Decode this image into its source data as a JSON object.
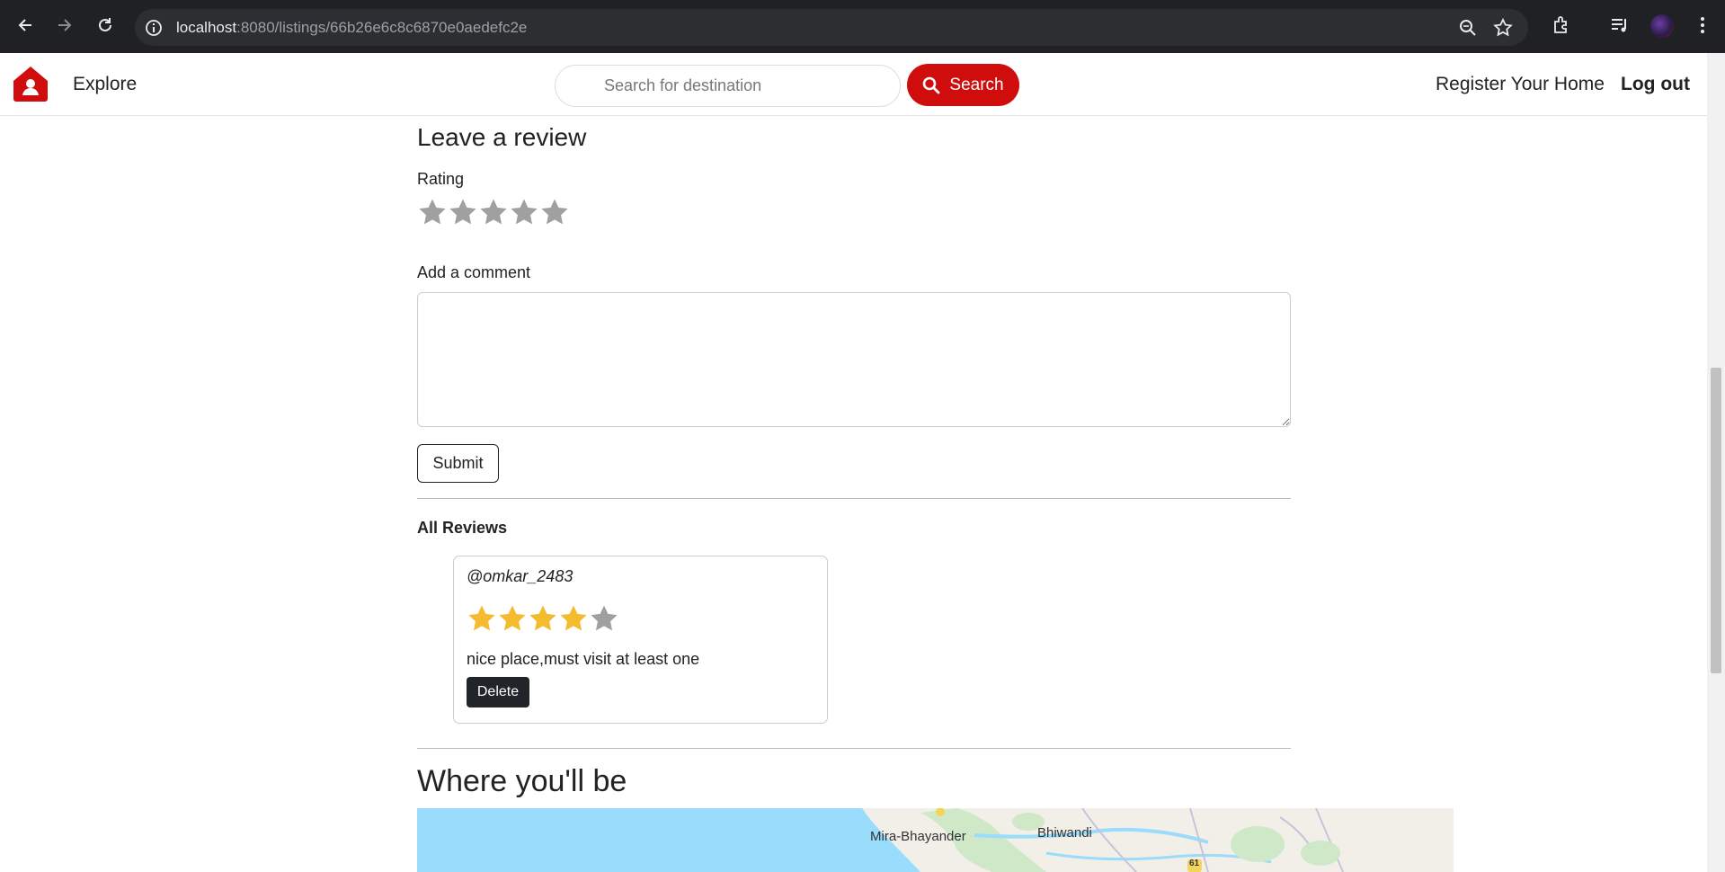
{
  "browser": {
    "url_host": "localhost",
    "url_path": ":8080/listings/66b26e6c8c6870e0aedefc2e"
  },
  "navbar": {
    "explore_label": "Explore",
    "search_placeholder": "Search for destination",
    "search_button_label": "Search",
    "register_label": "Register Your Home",
    "logout_label": "Log out",
    "brand_color": "#d00d0d"
  },
  "review_form": {
    "heading": "Leave a review",
    "rating_label": "Rating",
    "rating_value": 0,
    "rating_max": 5,
    "comment_label": "Add a comment",
    "comment_value": "",
    "submit_label": "Submit"
  },
  "reviews": {
    "heading": "All Reviews",
    "items": [
      {
        "author": "@omkar_2483",
        "rating": 4,
        "rating_max": 5,
        "comment": "nice place,must visit at least one",
        "delete_label": "Delete"
      }
    ]
  },
  "location": {
    "heading": "Where you'll be",
    "map_labels": [
      "Mira-Bhayander",
      "Bhiwandi"
    ],
    "road_marker": "61"
  },
  "colors": {
    "star_filled": "#f4bb2f",
    "star_empty": "#a0a0a0",
    "map_water": "#9adcfb",
    "map_land": "#f2efe9"
  }
}
